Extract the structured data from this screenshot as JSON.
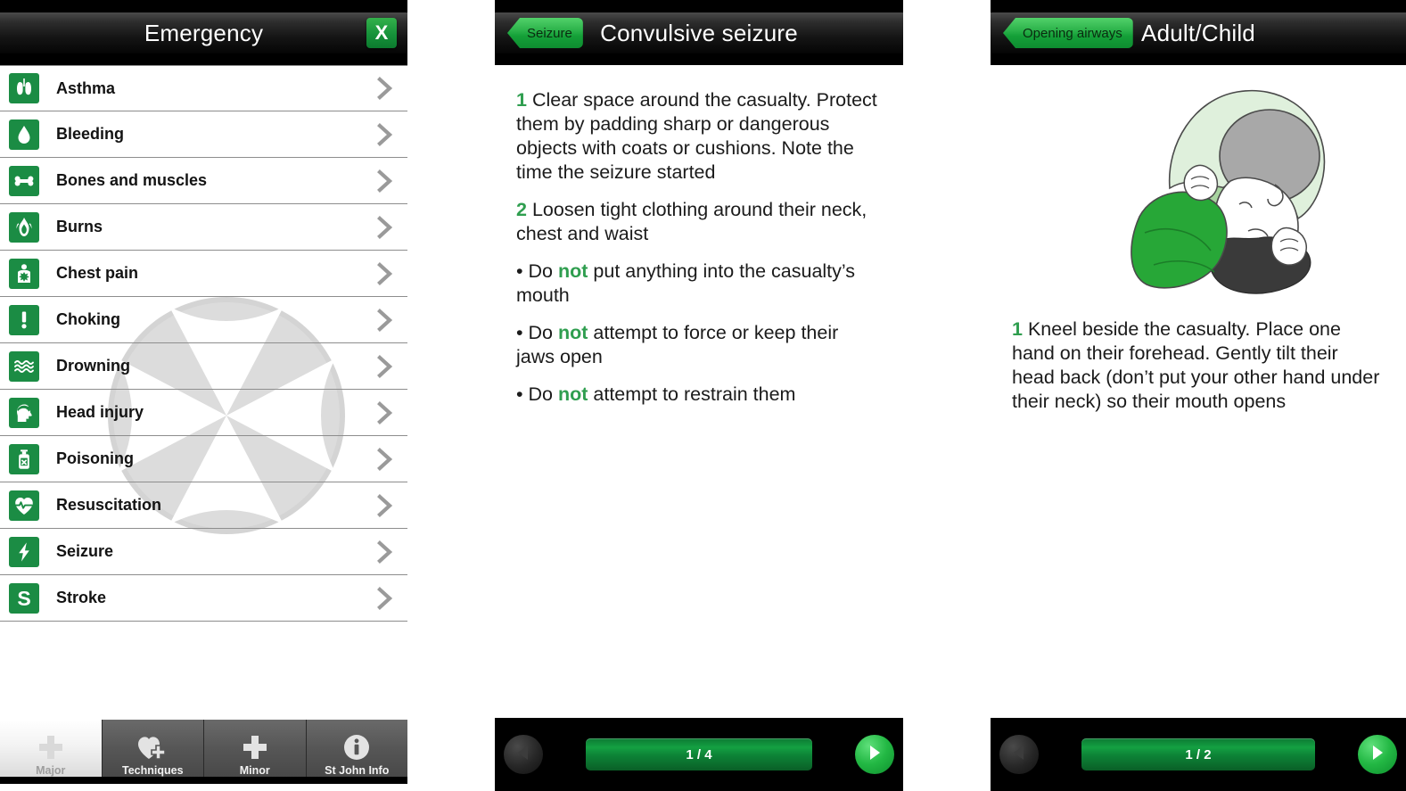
{
  "accent_green": "#1b8c44",
  "bright_green": "#2f9e4f",
  "panel_major": {
    "header": {
      "title": "Emergency",
      "close_label": "X"
    },
    "list": [
      {
        "label": "Asthma",
        "icon": "lungs-icon"
      },
      {
        "label": "Bleeding",
        "icon": "blood-drop-icon"
      },
      {
        "label": "Bones and muscles",
        "icon": "bone-icon"
      },
      {
        "label": "Burns",
        "icon": "flame-icon"
      },
      {
        "label": "Chest pain",
        "icon": "chest-pain-icon"
      },
      {
        "label": "Choking",
        "icon": "exclamation-icon"
      },
      {
        "label": "Drowning",
        "icon": "waves-icon"
      },
      {
        "label": "Head injury",
        "icon": "head-bandage-icon"
      },
      {
        "label": "Poisoning",
        "icon": "poison-bottle-icon"
      },
      {
        "label": "Resuscitation",
        "icon": "heart-pulse-icon"
      },
      {
        "label": "Seizure",
        "icon": "lightning-bolt-icon"
      },
      {
        "label": "Stroke",
        "icon": "letter-s-icon"
      }
    ],
    "tabs": [
      {
        "label": "Major",
        "icon": "plus-icon",
        "active": true
      },
      {
        "label": "Techniques",
        "icon": "heart-plus-icon",
        "active": false
      },
      {
        "label": "Minor",
        "icon": "plus-icon",
        "active": false
      },
      {
        "label": "St John Info",
        "icon": "info-icon",
        "active": false
      }
    ]
  },
  "panel_seizure": {
    "header": {
      "back_label": "Seizure",
      "title": "Convulsive seizure"
    },
    "steps": [
      {
        "kind": "numbered",
        "num": "1",
        "text": "Clear space around the casualty. Protect them by padding sharp or dangerous objects with coats or cushions. Note the time the seizure started"
      },
      {
        "kind": "numbered",
        "num": "2",
        "text": "Loosen tight clothing around their neck, chest and waist"
      },
      {
        "kind": "bullet",
        "bullet": "•",
        "lead": "Do",
        "emph": "not",
        "text": "put anything into the casualty’s mouth"
      },
      {
        "kind": "bullet",
        "bullet": "•",
        "lead": "Do",
        "emph": "not",
        "text": "attempt to force or keep their jaws open"
      },
      {
        "kind": "bullet",
        "bullet": "•",
        "lead": "Do",
        "emph": "not",
        "text": "attempt to restrain them"
      }
    ],
    "pager": {
      "counter": "1 / 4",
      "prev_icon": "triangle-left-icon",
      "next_icon": "triangle-right-icon"
    }
  },
  "panel_airway": {
    "header": {
      "back_label": "Opening airways",
      "title": "Adult/Child"
    },
    "illustration": "head-tilt-chin-lift-illustration",
    "steps": [
      {
        "kind": "numbered",
        "num": "1",
        "text": "Kneel beside the casualty. Place one hand on their forehead. Gently tilt their head back (don’t put your other hand under their neck) so their mouth opens"
      }
    ],
    "pager": {
      "counter": "1 / 2",
      "prev_icon": "triangle-left-icon",
      "next_icon": "triangle-right-icon"
    }
  }
}
